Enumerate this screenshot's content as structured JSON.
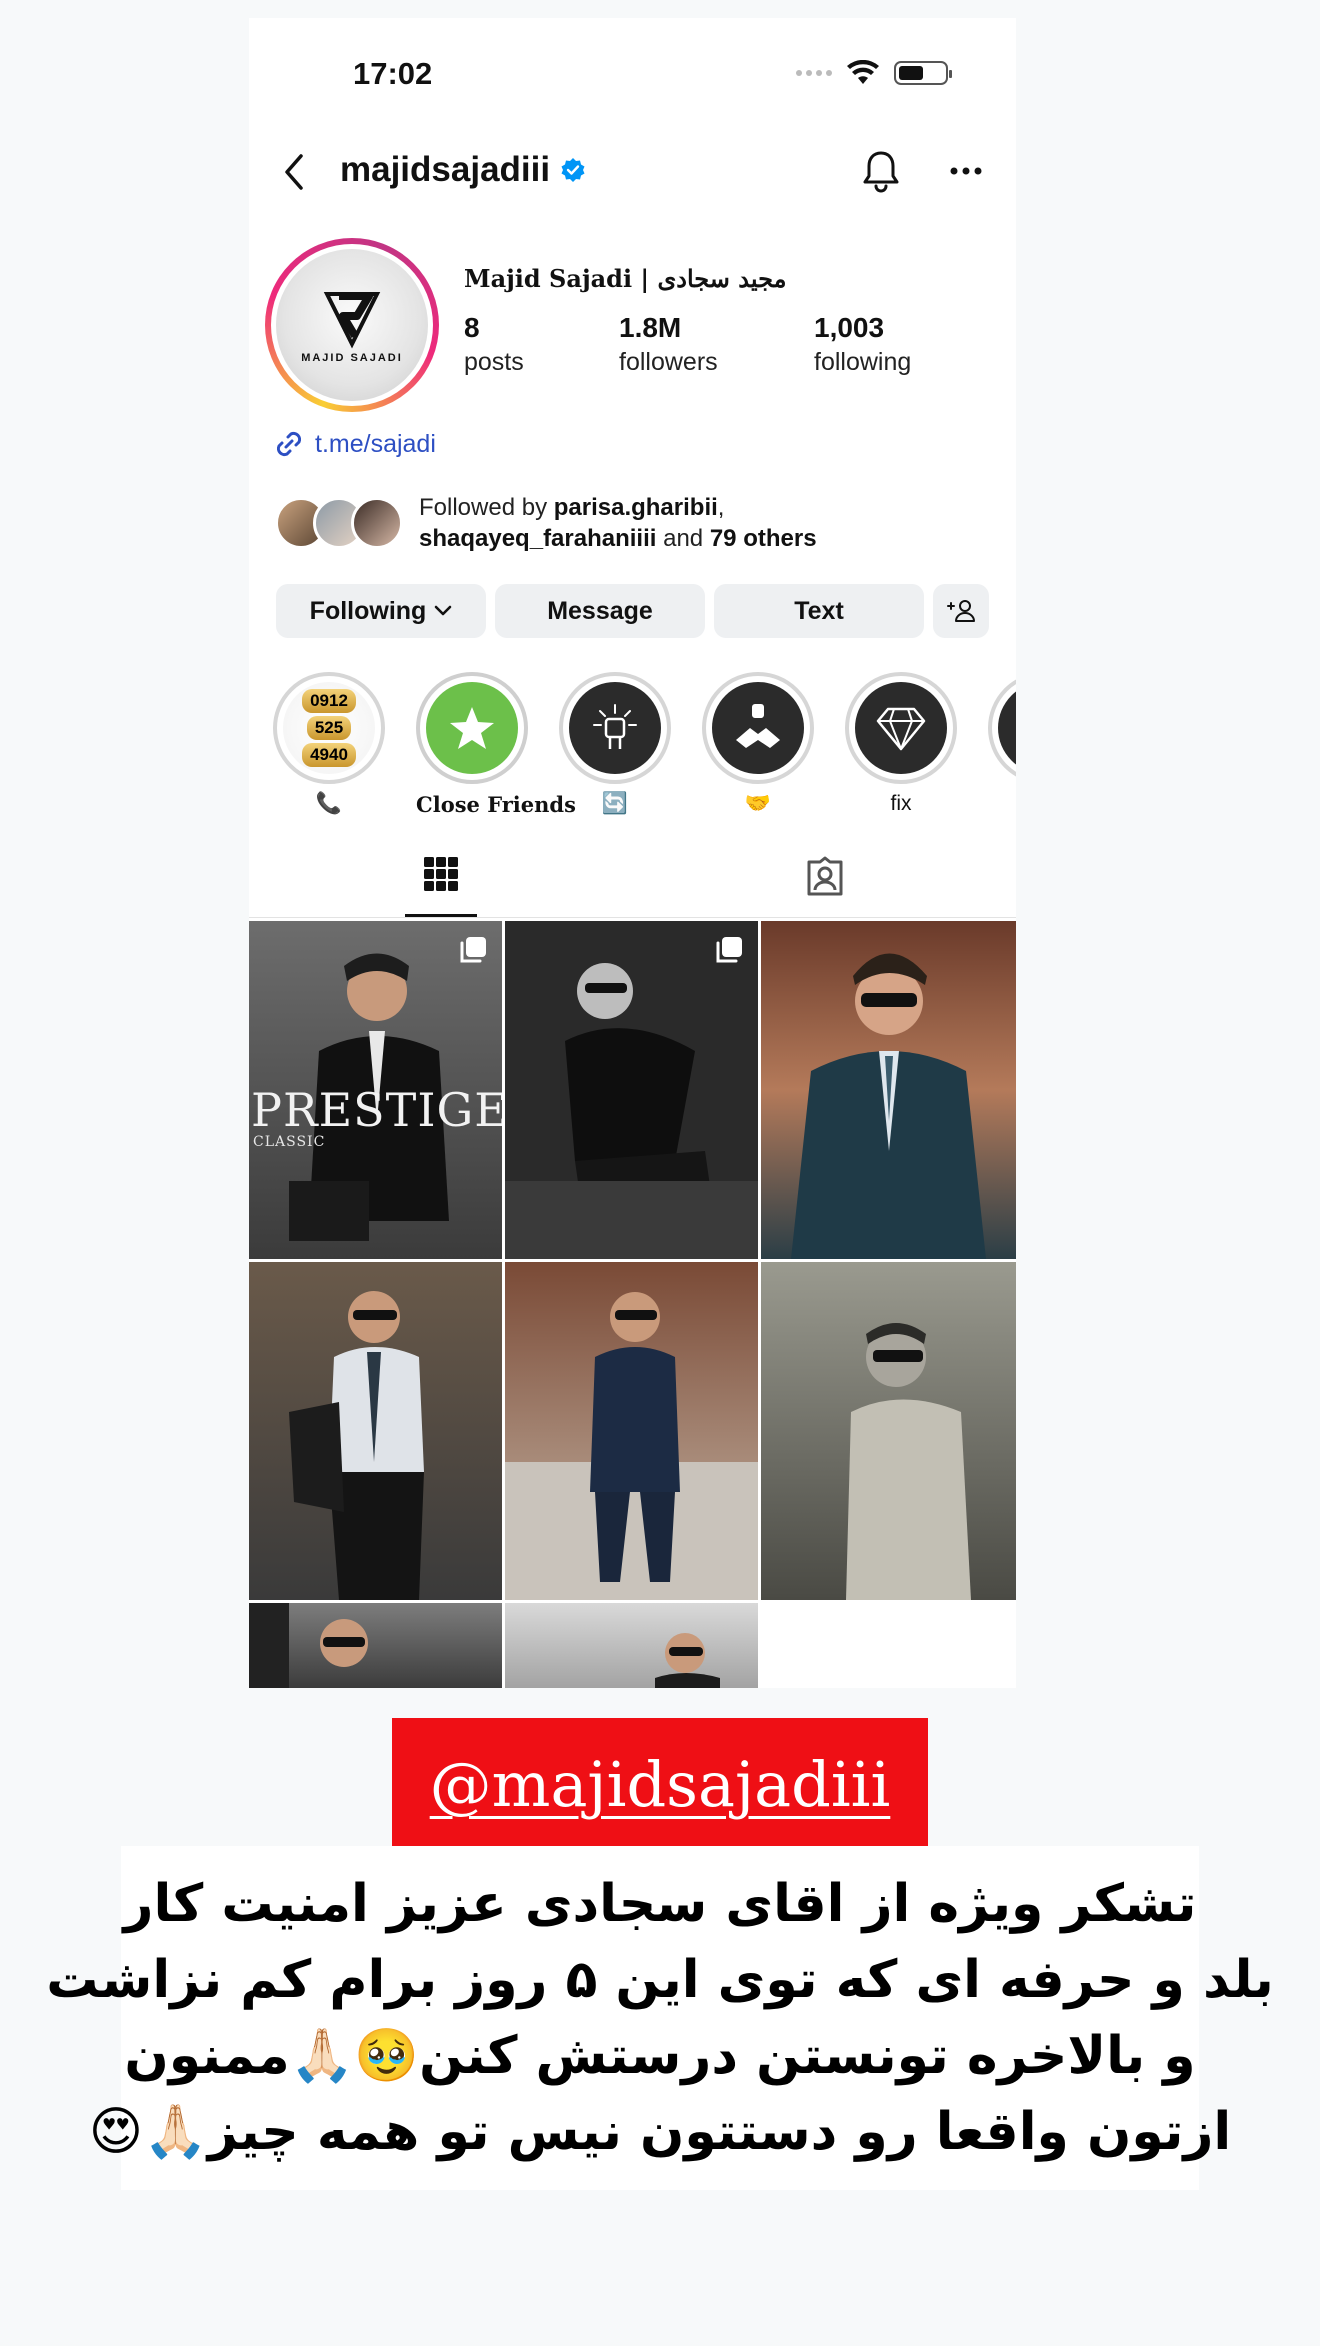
{
  "status_bar": {
    "time": "17:02",
    "battery_level": 0.55
  },
  "header": {
    "username": "majidsajadiii",
    "verified": true
  },
  "profile": {
    "display_name": "Majid Sajadi | مجید سجادی",
    "avatar_text": "MAJID SAJADI",
    "stats": [
      {
        "value": "8",
        "label": "posts"
      },
      {
        "value": "1.8M",
        "label": "followers"
      },
      {
        "value": "1,003",
        "label": "following"
      }
    ],
    "link": "t.me/sajadi",
    "followed_by": {
      "prefix": "Followed by ",
      "user1": "parisa.gharibii",
      "comma": ",",
      "user2": "shaqayeq_farahaniiii",
      "and": " and ",
      "others": "79 others"
    }
  },
  "buttons": {
    "following": "Following",
    "message": "Message",
    "text": "Text"
  },
  "highlights": [
    {
      "label": "📞",
      "numbers": [
        "0912",
        "525",
        "4940"
      ]
    },
    {
      "label": "Close Friends"
    },
    {
      "label": "🔄"
    },
    {
      "label": "🤝"
    },
    {
      "label": "fix"
    }
  ],
  "posts": [
    {
      "overlay_title": "PRESTIGE",
      "overlay_sub": "CLASSIC"
    }
  ],
  "caption": {
    "handle": "@majidsajadiii",
    "lines": [
      "تشکر ویژه از اقای سجادی عزیز امنیت کار",
      "بلد و حرفه ای که توی این ۵ روز برام کم نزاشت",
      "و بالاخره تونستن درستش کنن🥹🙏🏻ممنون",
      "ازتون واقعا رو دستتون نیس تو همه چیز🙏🏻😍"
    ]
  },
  "colors": {
    "link": "#2d4fc3",
    "verified": "#0095f6",
    "banner": "#ef0f15",
    "button_bg": "#eef0f2"
  }
}
